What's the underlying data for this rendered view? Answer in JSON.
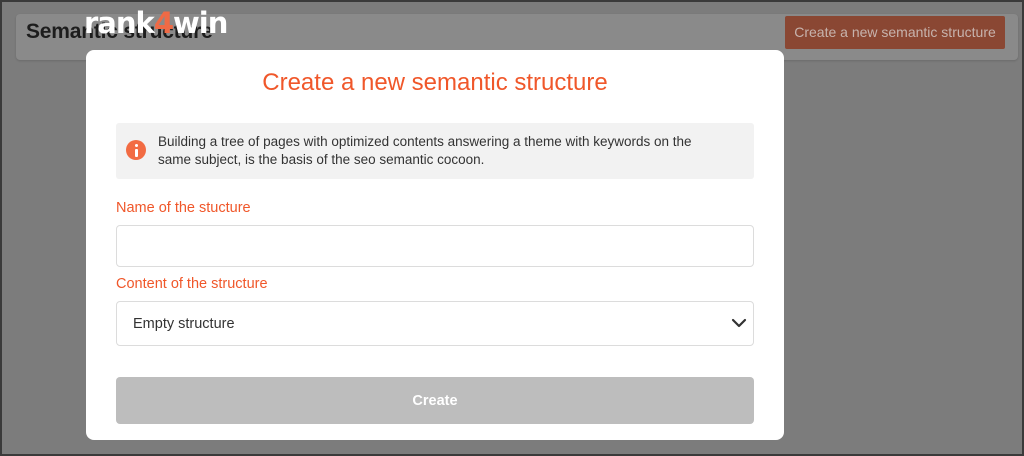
{
  "brand": {
    "logo_part1": "rank",
    "logo_part2": "4",
    "logo_part3": "win"
  },
  "background": {
    "page_title": "Semantic structure",
    "create_button_label": "Create a new semantic structure"
  },
  "modal": {
    "title": "Create a new semantic structure",
    "info": {
      "icon": "info-icon",
      "text": "Building a tree of pages with optimized contents answering a theme with keywords on the same subject, is the basis of the seo semantic cocoon."
    },
    "name_field": {
      "label": "Name of the stucture",
      "value": "",
      "placeholder": ""
    },
    "content_field": {
      "label": "Content of the structure",
      "selected": "Empty structure",
      "icon": "chevron-down-icon"
    },
    "submit_label": "Create"
  },
  "colors": {
    "accent": "#f0572a",
    "overlay": "#7c7c7c",
    "disabled_button": "#bdbdbd",
    "info_background": "#f2f2f2"
  }
}
